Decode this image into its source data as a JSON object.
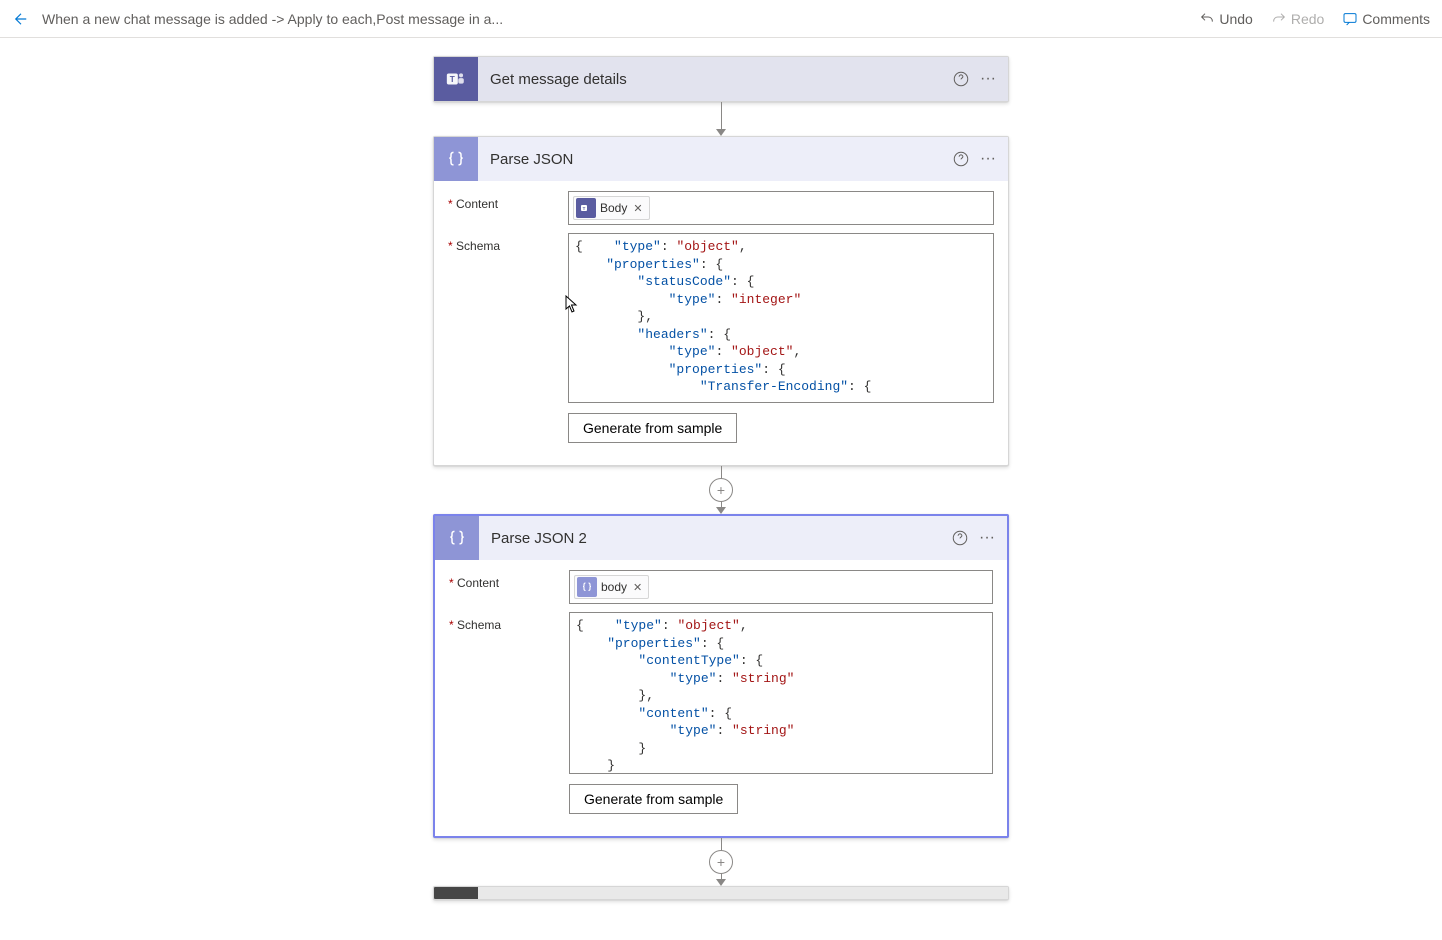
{
  "top": {
    "breadcrumb": "When a new chat message is added -> Apply to each,Post message in a...",
    "undo": "Undo",
    "redo": "Redo",
    "comments": "Comments"
  },
  "card0": {
    "title": "Get message details"
  },
  "card1": {
    "title": "Parse JSON",
    "content_label": "Content",
    "schema_label": "Schema",
    "pill_label": "Body",
    "generate": "Generate from sample",
    "schema_tokens": [
      [
        "p",
        "{"
      ],
      [
        "k",
        "    \"type\""
      ],
      [
        "p",
        ": "
      ],
      [
        "s",
        "\"object\""
      ],
      [
        "p",
        ",\n"
      ],
      [
        "k",
        "    \"properties\""
      ],
      [
        "p",
        ": {\n"
      ],
      [
        "k",
        "        \"statusCode\""
      ],
      [
        "p",
        ": {\n"
      ],
      [
        "k",
        "            \"type\""
      ],
      [
        "p",
        ": "
      ],
      [
        "s",
        "\"integer\""
      ],
      [
        "p",
        "\n        },\n"
      ],
      [
        "k",
        "        \"headers\""
      ],
      [
        "p",
        ": {\n"
      ],
      [
        "k",
        "            \"type\""
      ],
      [
        "p",
        ": "
      ],
      [
        "s",
        "\"object\""
      ],
      [
        "p",
        ",\n"
      ],
      [
        "k",
        "            \"properties\""
      ],
      [
        "p",
        ": {\n"
      ],
      [
        "k",
        "                \"Transfer-Encoding\""
      ],
      [
        "p",
        ": {"
      ]
    ]
  },
  "card2": {
    "title": "Parse JSON 2",
    "content_label": "Content",
    "schema_label": "Schema",
    "pill_label": "body",
    "generate": "Generate from sample",
    "schema_tokens": [
      [
        "p",
        "{"
      ],
      [
        "k",
        "    \"type\""
      ],
      [
        "p",
        ": "
      ],
      [
        "s",
        "\"object\""
      ],
      [
        "p",
        ",\n"
      ],
      [
        "k",
        "    \"properties\""
      ],
      [
        "p",
        ": {\n"
      ],
      [
        "k",
        "        \"contentType\""
      ],
      [
        "p",
        ": {\n"
      ],
      [
        "k",
        "            \"type\""
      ],
      [
        "p",
        ": "
      ],
      [
        "s",
        "\"string\""
      ],
      [
        "p",
        "\n        },\n"
      ],
      [
        "k",
        "        \"content\""
      ],
      [
        "p",
        ": {\n"
      ],
      [
        "k",
        "            \"type\""
      ],
      [
        "p",
        ": "
      ],
      [
        "s",
        "\"string\""
      ],
      [
        "p",
        "\n        }\n    }"
      ]
    ]
  }
}
